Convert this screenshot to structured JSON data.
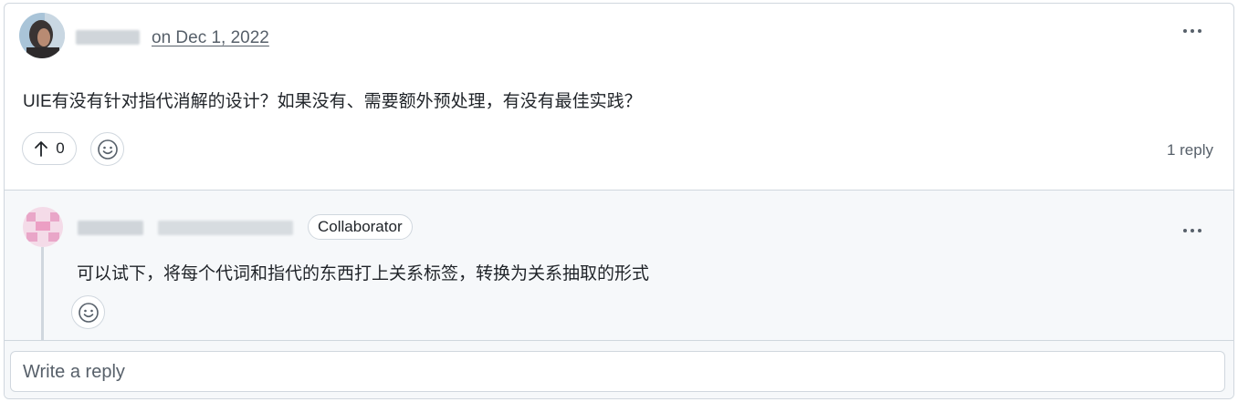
{
  "post": {
    "date": "on Dec 1, 2022",
    "body": "UIE有没有针对指代消解的设计？如果没有、需要额外预处理，有没有最佳实践？",
    "upvote_count": "0",
    "reply_count": "1 reply"
  },
  "reply": {
    "badge": "Collaborator",
    "body": "可以试下，将每个代词和指代的东西打上关系标签，转换为关系抽取的形式"
  },
  "composer": {
    "placeholder": "Write a reply"
  },
  "colors": {
    "border": "#d0d7de",
    "muted_text": "#57606a",
    "reply_background": "#f6f8fa"
  }
}
